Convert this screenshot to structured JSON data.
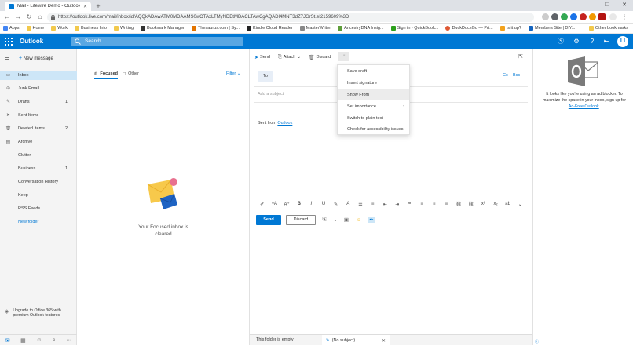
{
  "browser": {
    "tab_title": "Mail - Lifewire Demo - Outlook",
    "new_tab": "+",
    "url": "https://outlook.live.com/mail/inbox/id/AQQkADAwATM0MDAAMS0wOTAxLTMyNDEtMDACLTAwCgAQADl4MNT3dZ7JGrSt.eI2159609%3D",
    "window_controls": [
      "–",
      "❐",
      "✕"
    ],
    "bookmarks": [
      "Apps",
      "Home",
      "Work",
      "Business Info",
      "Writing",
      "Bookmark Manager",
      "Thesaurus.com | Sy...",
      "Kindle Cloud Reader",
      "MasterWriter",
      "AncestryDNA Insig...",
      "Sign in - QuickBook...",
      "DuckDuckGo — Pri...",
      "Is it up?",
      "Members Site | DIY..."
    ],
    "other_bookmarks": "Other bookmarks"
  },
  "header": {
    "brand": "Outlook",
    "search_placeholder": "Search",
    "avatar_initial": "LI",
    "colors": {
      "accent": "#0078d4"
    }
  },
  "nav": {
    "new_message": "New message",
    "items": [
      {
        "label": "Inbox",
        "icon": "inbox-icon",
        "count": "",
        "active": true
      },
      {
        "label": "Junk Email",
        "icon": "junk-icon",
        "count": ""
      },
      {
        "label": "Drafts",
        "icon": "drafts-icon",
        "count": "1"
      },
      {
        "label": "Sent Items",
        "icon": "sent-icon",
        "count": ""
      },
      {
        "label": "Deleted Items",
        "icon": "trash-icon",
        "count": "2"
      },
      {
        "label": "Archive",
        "icon": "archive-icon",
        "count": ""
      },
      {
        "label": "Clutter",
        "icon": "",
        "count": ""
      },
      {
        "label": "Business",
        "icon": "",
        "count": "1"
      },
      {
        "label": "Conversation History",
        "icon": "",
        "count": ""
      },
      {
        "label": "Keep",
        "icon": "",
        "count": ""
      },
      {
        "label": "RSS Feeds",
        "icon": "",
        "count": ""
      },
      {
        "label": "New folder",
        "icon": "",
        "count": "",
        "link": true
      }
    ],
    "upgrade": "Upgrade to Office 365 with premium Outlook features"
  },
  "message_list": {
    "tab_focused": "Focused",
    "tab_other": "Other",
    "filter": "Filter",
    "empty_text": "Your Focused inbox is cleared"
  },
  "compose": {
    "toolbar": {
      "send": "Send",
      "attach": "Attach",
      "discard": "Discard",
      "more": "···"
    },
    "to_label": "To",
    "cc": "Cc",
    "bcc": "Bcc",
    "subject_placeholder": "Add a subject",
    "body_prefix": "Sent from",
    "body_link": "Outlook",
    "send_button": "Send",
    "discard_button": "Discard",
    "format_icons": [
      "brush",
      "font-size",
      "A",
      "B",
      "I",
      "U",
      "highlight",
      "font-color",
      "bullets",
      "numbering",
      "outdent",
      "indent",
      "quote",
      "align-left",
      "align-center",
      "align-right",
      "link",
      "unlink",
      "superscript",
      "subscript",
      "strikethrough",
      "more"
    ]
  },
  "dropdown": {
    "items": [
      {
        "label": "Save draft"
      },
      {
        "label": "Insert signature"
      },
      {
        "label": "Show From",
        "hover": true
      },
      {
        "label": "Set importance",
        "submenu": true
      },
      {
        "label": "Switch to plain text"
      },
      {
        "label": "Check for accessibility issues"
      }
    ]
  },
  "right_pane": {
    "ad_text": "It looks like you're using an ad blocker. To maximize the space in your inbox, sign up for",
    "ad_link": "Ad-Free Outlook",
    "ad_suffix": ".",
    "ad_choice": "ⓘ"
  },
  "status": {
    "folder_empty": "This folder is empty",
    "draft_tab": "(No subject)"
  }
}
